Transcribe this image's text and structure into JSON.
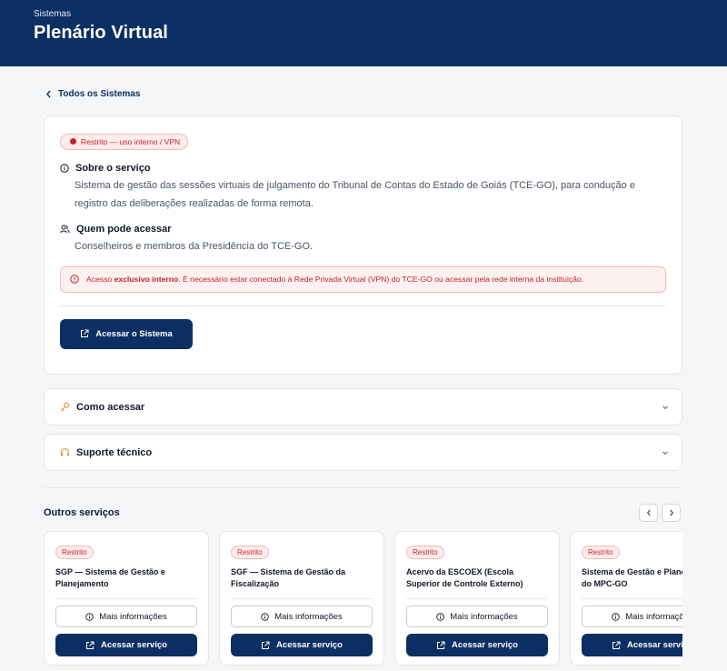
{
  "header": {
    "subtitle": "Sistemas",
    "title": "Plenário Virtual"
  },
  "back_link": "Todos os Sistemas",
  "main": {
    "badge": "Restrito — uso interno / VPN",
    "about_title": "Sobre o serviço",
    "about_text": "Sistema de gestão das sessões virtuais de julgamento do Tribunal de Contas do Estado de Goiás (TCE-GO), para condução e registro das deliberações realizadas de forma remota.",
    "who_title": "Quem pode acessar",
    "who_text": "Conselheiros e membros da Presidência do TCE-GO.",
    "alert_prefix": "Acesso ",
    "alert_bold": "exclusivo interno",
    "alert_suffix": ". É necessário estar conectado à Rede Privada Virtual (VPN) do TCE-GO ou acessar pela rede interna da instituição.",
    "access_button": "Acessar o Sistema"
  },
  "accordions": [
    {
      "label": "Como acessar",
      "icon": "key-icon"
    },
    {
      "label": "Suporte técnico",
      "icon": "headset-icon"
    }
  ],
  "others": {
    "title": "Outros serviços",
    "services": [
      {
        "badge": "Restrito",
        "name": "SGP — Sistema de Gestão e Planejamento",
        "info": "Mais informações",
        "access": "Acessar serviço"
      },
      {
        "badge": "Restrito",
        "name": "SGF — Sistema de Gestão da Fiscalização",
        "info": "Mais informações",
        "access": "Acessar serviço"
      },
      {
        "badge": "Restrito",
        "name": "Acervo da ESCOEX (Escola Superior de Controle Externo)",
        "info": "Mais informações",
        "access": "Acessar serviço"
      },
      {
        "badge": "Restrito",
        "name": "Sistema de Gestão e Planejamento do MPC-GO",
        "info": "Mais informações",
        "access": "Acessar serviço"
      }
    ]
  },
  "colors": {
    "brand": "#0b2f63",
    "danger": "#c0262d",
    "accent_orange": "#e8892b"
  }
}
